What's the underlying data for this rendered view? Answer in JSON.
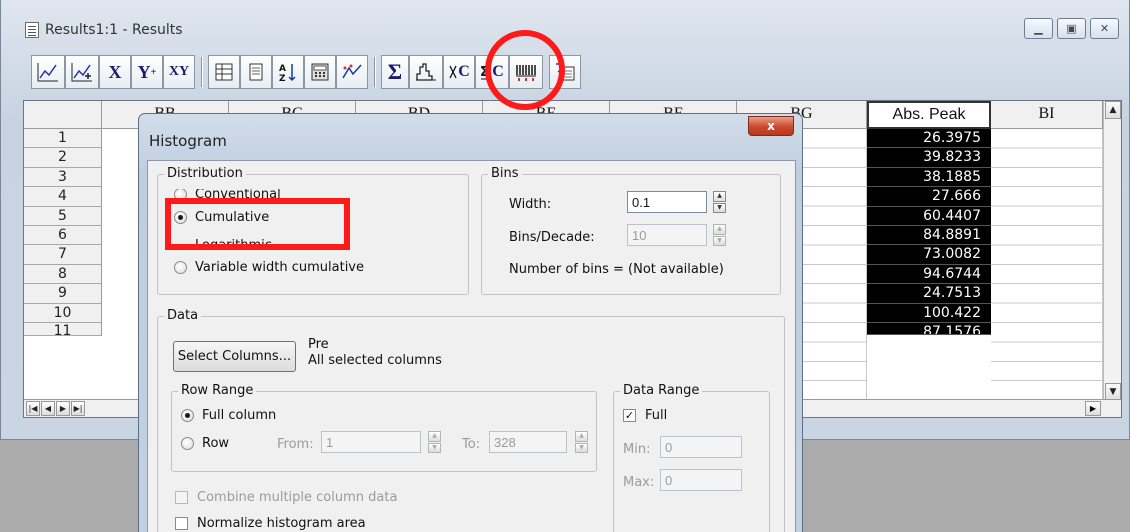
{
  "window": {
    "title": "Results1:1 - Results",
    "caption_buttons": [
      "minimize",
      "restore",
      "close"
    ]
  },
  "toolbar": {
    "x_label": "X",
    "y_label": "Y",
    "xy_label": "XY",
    "sigma": "Σ",
    "c_label_1": "C",
    "c_label_2": "C"
  },
  "sheet": {
    "columns": [
      "BB",
      "BC",
      "BD",
      "BE",
      "BF",
      "BG",
      "Abs. Peak",
      "BI"
    ],
    "selected_column": "Abs. Peak",
    "row_numbers": [
      "1",
      "2",
      "3",
      "4",
      "5",
      "6",
      "7",
      "8",
      "9",
      "10",
      "11"
    ],
    "abs_peak_values": [
      "26.3975",
      "39.8233",
      "38.1885",
      "27.666",
      "60.4407",
      "84.8891",
      "73.0082",
      "94.6744",
      "24.7513",
      "100.422",
      "87.1576"
    ]
  },
  "dialog": {
    "title": "Histogram",
    "close_label": "x",
    "distribution": {
      "label": "Distribution",
      "options": [
        "Conventional",
        "Cumulative",
        "Logarithmic",
        "Variable width cumulative"
      ],
      "selected": "Cumulative"
    },
    "bins": {
      "label": "Bins",
      "width_label": "Width:",
      "width_value": "0.1",
      "bins_decade_label": "Bins/Decade:",
      "bins_decade_value": "10",
      "number_of_bins": "Number of bins = (Not available)"
    },
    "data": {
      "label": "Data",
      "select_columns_button": "Select Columns...",
      "columns_line1": "Pre",
      "columns_line2": "All selected columns"
    },
    "row_range": {
      "label": "Row Range",
      "full_column": "Full column",
      "row": "Row",
      "from_label": "From:",
      "from_value": "1",
      "to_label": "To:",
      "to_value": "328"
    },
    "data_range": {
      "label": "Data Range",
      "full_label": "Full",
      "full_checked": true,
      "min_label": "Min:",
      "min_value": "0",
      "max_label": "Max:",
      "max_value": "0"
    },
    "combine_label": "Combine multiple column data",
    "normalize_label": "Normalize histogram area"
  },
  "colors": {
    "annotation_red": "#ff1a1a",
    "selected_cell_bg": "#000000"
  }
}
